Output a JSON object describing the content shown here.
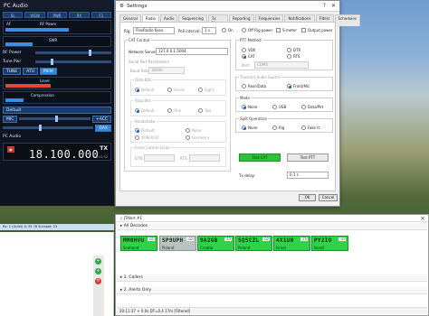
{
  "radio_window": {
    "title": "PC Audio",
    "top_buttons": [
      "SL",
      "VIEW",
      "PWR",
      "RX",
      "F1"
    ],
    "row1_label": "AF",
    "row2_label": "RF Power",
    "swr_label": "SWR",
    "rf_power_button": "RF Power",
    "tune_button": "Tune Pwr",
    "mode_buttons": [
      "TUNE",
      "ATU",
      "MEM"
    ],
    "level_label": "Level",
    "compression_label": "Compression",
    "default_label": "Default",
    "mic_button": "MIC",
    "acc_button": "+ACC",
    "dax_button": "DAX",
    "pc_audio_label": "PC Audio",
    "frequency": "18.100.000",
    "tx_label": "TX",
    "time": "20:11:32"
  },
  "settings": {
    "title": "Settings",
    "tabs": [
      "General",
      "Radio",
      "Audio",
      "Sequencing",
      "Tx Macros",
      "Reporting",
      "Frequencies",
      "Notifications",
      "Filters",
      "Schedules"
    ],
    "active_tab": "Radio",
    "rig_label": "Rig:",
    "rig_value": "FlexRadio 6xxx",
    "poll_interval_label": "Poll interval:",
    "poll_interval_value": "1 s",
    "top_radios": [
      "On",
      "Off Rig power",
      "S-meter",
      "Output power"
    ],
    "cat_control": {
      "title": "CAT Control",
      "network_server_label": "Network Server:",
      "network_server_value": "127.0.0.1:5004",
      "serial_port_params": "Serial Port Parameters",
      "baud_rate_label": "Baud Rate:",
      "baud_rate_value": "19200",
      "data_bits_title": "Data Bits",
      "data_bits_options": [
        "Default",
        "Seven",
        "Eight"
      ],
      "stop_bits_title": "Stop Bits",
      "stop_bits_options": [
        "Default",
        "One",
        "Two"
      ],
      "handshake_title": "Handshake",
      "handshake_options": [
        "Default",
        "None",
        "XON/XOFF",
        "Hardware"
      ],
      "force_control_title": "Force Control Lines",
      "dtr_label": "DTR:",
      "rts_label": "RTS:"
    },
    "ptt_method": {
      "title": "PTT Method",
      "options": [
        "VOX",
        "DTR",
        "CAT",
        "RTS"
      ],
      "selected": "CAT",
      "port_label": "Port:",
      "port_value": "COM4"
    },
    "transmit_audio": {
      "title": "Transmit Audio Source",
      "options": [
        "Rear/Data",
        "Front/Mic"
      ],
      "selected": "Front/Mic"
    },
    "mode": {
      "title": "Mode",
      "options": [
        "None",
        "USB",
        "Data/Pkt"
      ],
      "selected": "None"
    },
    "split": {
      "title": "Split Operation",
      "options": [
        "None",
        "Rig",
        "Fake It"
      ],
      "selected": "None"
    },
    "test_cat_button": "Test CAT",
    "test_ptt_button": "Test PTT",
    "tx_delay_label": "Tx delay:",
    "tx_delay_value": "0.1 s",
    "ok_button": "OK",
    "cancel_button": "Cancel"
  },
  "left_band_text": "Rx: 1 (Quiet) A: 55 76 Sunspot: 25",
  "decoder": {
    "title": "JTAlert #1",
    "all_decodes_label": "All Decodes",
    "close_label": "×",
    "cards": [
      {
        "call": "MM0HVU",
        "db": "-01",
        "country": "Scotland",
        "style": "green"
      },
      {
        "call": "SP9UPH",
        "db": "-02",
        "country": "Poland",
        "style": "gray"
      },
      {
        "call": "9A2GB",
        "db": "-13",
        "country": "Croatia",
        "style": "green"
      },
      {
        "call": "SQ5CZL",
        "db": "-02",
        "country": "Poland",
        "style": "green"
      },
      {
        "call": "4X1UN",
        "db": "-10",
        "country": "Israel",
        "style": "green"
      },
      {
        "call": "PY2IO",
        "db": "-03",
        "country": "Brazil",
        "style": "green"
      }
    ],
    "callers_label": "1. Callers",
    "alerts_label": "2. Alerts Only",
    "status_line": "20:11:37    +    0.0s    DT=0.4    17m    [Filtered]"
  }
}
